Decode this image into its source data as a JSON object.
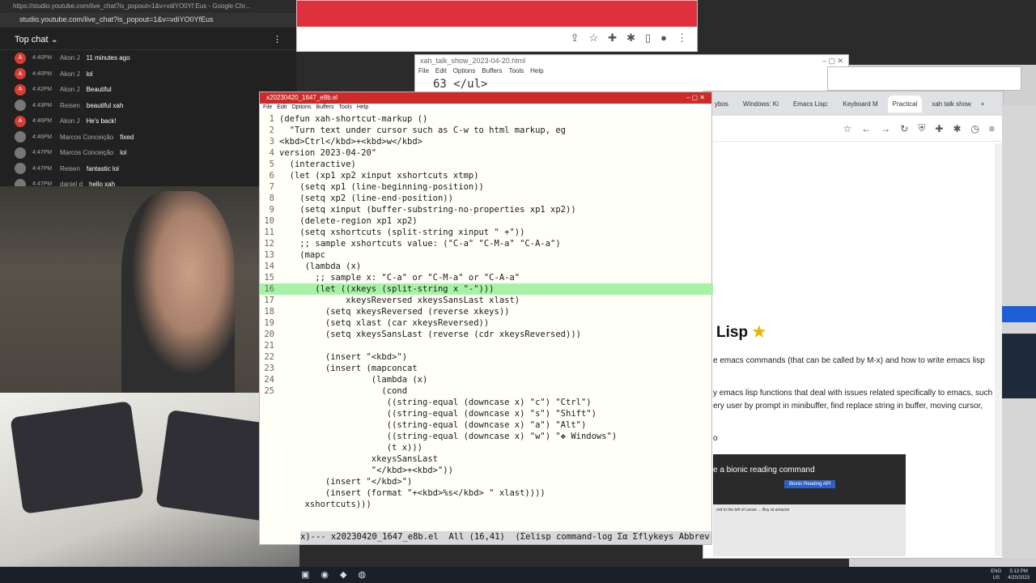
{
  "chat": {
    "url_title": "https://studio.youtube.com/live_chat?is_popout=1&v=vdiYO0Yf Eus - Google Chr...",
    "address": "studio.youtube.com/live_chat?is_popout=1&v=vdiYO0YfEus",
    "header": "Top chat",
    "messages": [
      {
        "initial": "A",
        "time": "4:40PM",
        "author": "Akon J",
        "text": "11 minutes ago"
      },
      {
        "initial": "A",
        "time": "4:40PM",
        "author": "Akon J",
        "text": "lol"
      },
      {
        "initial": "A",
        "time": "4:42PM",
        "author": "Akon J",
        "text": "Beautiful"
      },
      {
        "initial": "",
        "time": "4:43PM",
        "author": "Reisen",
        "text": "beautiful xah"
      },
      {
        "initial": "A",
        "time": "4:46PM",
        "author": "Akon J",
        "text": "He's back!"
      },
      {
        "initial": "",
        "time": "4:46PM",
        "author": "Marcos Conceição",
        "text": "fixed"
      },
      {
        "initial": "",
        "time": "4:47PM",
        "author": "Marcos Conceição",
        "text": "lol"
      },
      {
        "initial": "",
        "time": "4:47PM",
        "author": "Reisen",
        "text": "fantastic lol"
      },
      {
        "initial": "",
        "time": "4:47PM",
        "author": "daniel d",
        "text": "hello xah"
      }
    ]
  },
  "emacs2": {
    "title": "xah_talk_show_2023-04-20.html",
    "menus": [
      "File",
      "Edit",
      "Options",
      "Buffers",
      "Tools",
      "Help"
    ],
    "code": "63 </ul>"
  },
  "browser": {
    "tabs": [
      "ybos",
      "Windows: Ki",
      "Emacs Lisp:",
      "Keyboard M",
      "Practical",
      "xah talk show"
    ],
    "heading": "Lisp",
    "paragraphs": [
      "e emacs commands (that can be called by M-x) and how to write emacs lisp",
      "y emacs lisp functions that deal with issues related specifically to emacs, such as",
      "ery user by prompt in minibuffer, find replace string in buffer, moving cursor,",
      "o"
    ],
    "video_title": "e a bionic reading command",
    "video_button": "Bionic Reading API",
    "thumb_text": "ord to the left of cursor  ... Buy at amazon"
  },
  "emacs": {
    "title": "x20230420_1647_e8b.el",
    "menus": [
      "File",
      "Edit",
      "Options",
      "Buffers",
      "Tools",
      "Help"
    ],
    "modeline": "x)--- x20230420_1647_e8b.el  All (16,41)  (Σelisp command-log Σα Σflykeys Abbrev"
  },
  "code_lines": [
    {
      "n": "1",
      "t": "(defun xah-shortcut-markup ()"
    },
    {
      "n": "2",
      "t": "  \"Turn text under cursor such as C-w to html markup, eg"
    },
    {
      "n": "3",
      "t": "<kbd>Ctrl</kbd>+<kbd>w</kbd>"
    },
    {
      "n": "4",
      "t": "version 2023-04-20\""
    },
    {
      "n": "5",
      "t": "  (interactive)"
    },
    {
      "n": "6",
      "t": "  (let (xp1 xp2 xinput xshortcuts xtmp)"
    },
    {
      "n": "7",
      "t": "    (setq xp1 (line-beginning-position))"
    },
    {
      "n": "8",
      "t": "    (setq xp2 (line-end-position))"
    },
    {
      "n": "9",
      "t": "    (setq xinput (buffer-substring-no-properties xp1 xp2))"
    },
    {
      "n": "10",
      "t": "    (delete-region xp1 xp2)"
    },
    {
      "n": "11",
      "t": "    (setq xshortcuts (split-string xinput \" +\"))"
    },
    {
      "n": "12",
      "t": "    ;; sample xshortcuts value: (\"C-a\" \"C-M-a\" \"C-A-a\")"
    },
    {
      "n": "13",
      "t": "    (mapc"
    },
    {
      "n": "14",
      "t": "     (lambda (x)"
    },
    {
      "n": "15",
      "t": "       ;; sample x: \"C-a\" or \"C-M-a\" or \"C-A-a\""
    },
    {
      "n": "16",
      "t": "       (let ((xkeys (split-string x \"-\")))"
    },
    {
      "n": "17",
      "t": "             xkeysReversed xkeysSansLast xlast)"
    },
    {
      "n": "18",
      "t": "         (setq xkeysReversed (reverse xkeys))"
    },
    {
      "n": "19",
      "t": "         (setq xlast (car xkeysReversed))"
    },
    {
      "n": "20",
      "t": "         (setq xkeysSansLast (reverse (cdr xkeysReversed)))"
    },
    {
      "n": "21",
      "t": ""
    },
    {
      "n": "22",
      "t": "         (insert \"<kbd>\")"
    },
    {
      "n": "23",
      "t": "         (insert (mapconcat"
    },
    {
      "n": "24",
      "t": "                  (lambda (x)"
    },
    {
      "n": "25",
      "t": "                    (cond"
    },
    {
      "n": "",
      "t": "                     ((string-equal (downcase x) \"c\") \"Ctrl\")"
    },
    {
      "n": "",
      "t": "                     ((string-equal (downcase x) \"s\") \"Shift\")"
    },
    {
      "n": "",
      "t": "                     ((string-equal (downcase x) \"a\") \"Alt\")"
    },
    {
      "n": "",
      "t": "                     ((string-equal (downcase x) \"w\") \"❖ Windows\")"
    },
    {
      "n": "",
      "t": "                     (t x)))"
    },
    {
      "n": "",
      "t": "                  xkeysSansLast"
    },
    {
      "n": "",
      "t": "                  \"</kbd>+<kbd>\"))"
    },
    {
      "n": "",
      "t": "         (insert \"</kbd>\")"
    },
    {
      "n": "",
      "t": "         (insert (format \"+<kbd>%s</kbd> \" xlast))))"
    },
    {
      "n": "",
      "t": "     xshortcuts)))"
    }
  ],
  "taskbar": {
    "lang": "ENG",
    "region": "US",
    "time": "5:13 PM",
    "date": "4/20/2023"
  }
}
